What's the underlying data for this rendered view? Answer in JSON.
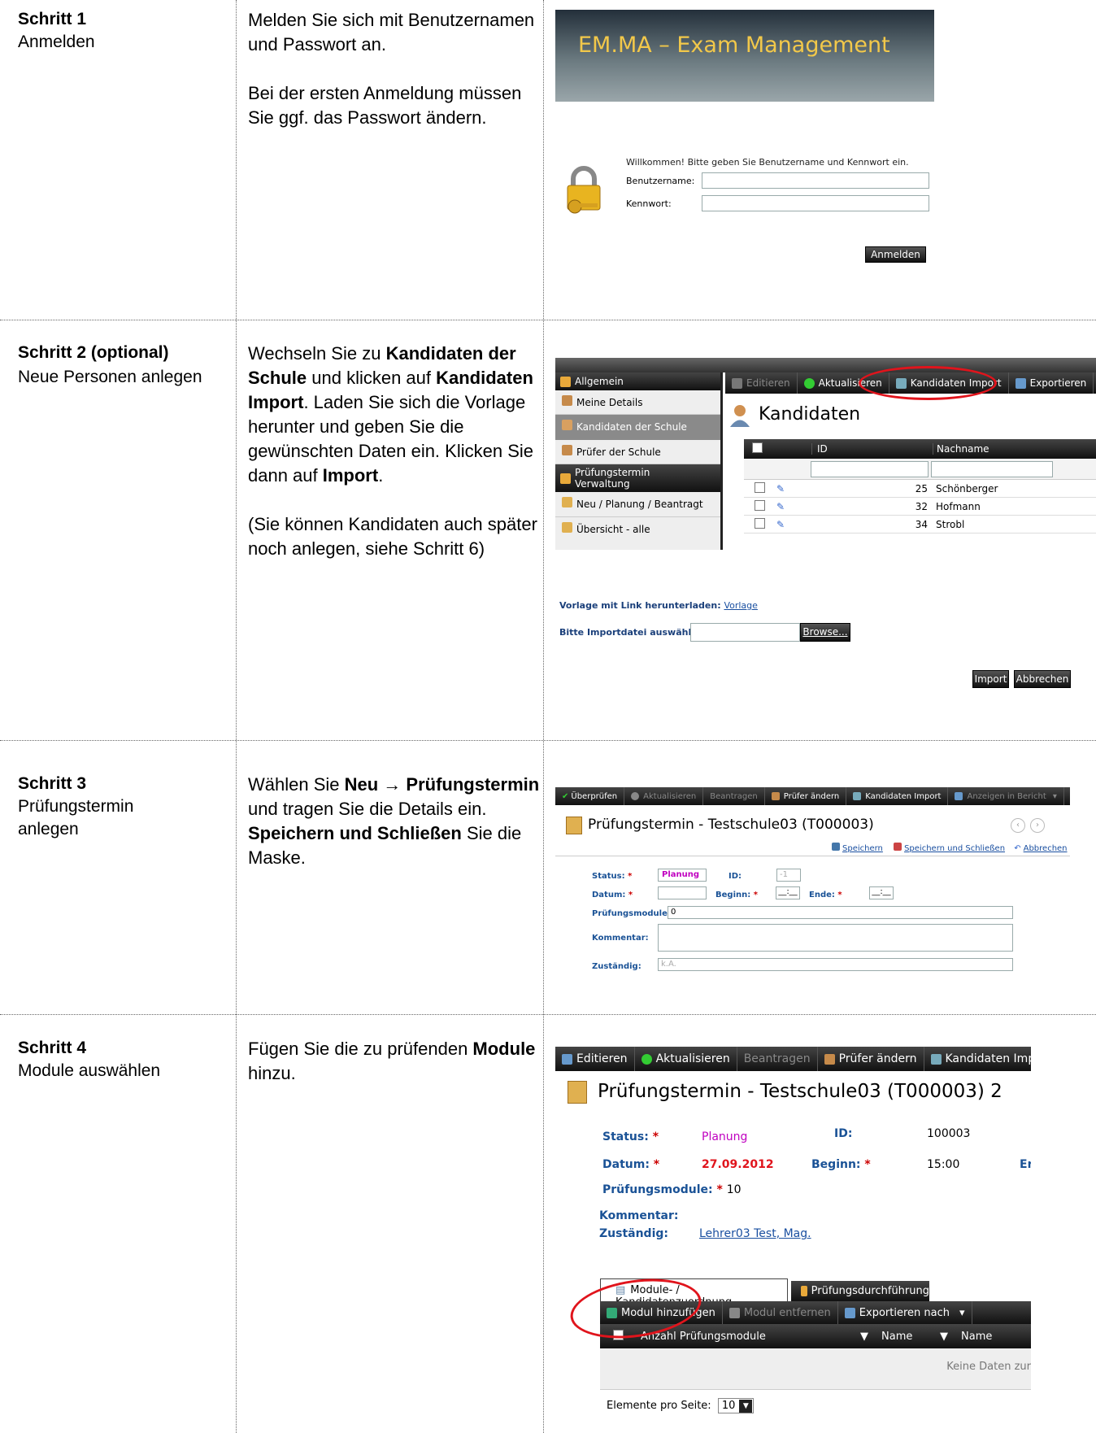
{
  "steps": [
    {
      "title": "Schritt 1",
      "subtitle": "Anmelden",
      "instruction": {
        "p1": "Melden Sie sich mit Benutzernamen und Passwort an.",
        "p2": "Bei der ersten Anmeldung müssen Sie ggf. das Passwort ändern."
      },
      "screenshot": {
        "banner_title": "EM.MA – Exam Management",
        "welcome": "Willkommen! Bitte geben Sie Benutzername und Kennwort ein.",
        "username_label": "Benutzername:",
        "username_value": "",
        "password_label": "Kennwort:",
        "password_value": "",
        "login_button": "Anmelden"
      }
    },
    {
      "title": "Schritt 2 (optional)",
      "subtitle": "Neue Personen anlegen",
      "instruction": {
        "t1": "Wechseln Sie zu ",
        "b1": "Kandidaten der Schule",
        "t2": " und klicken auf ",
        "b2": "Kandidaten Import",
        "t3": ". Laden Sie sich die Vorlage herunter und geben Sie die gewünschten Daten ein. Klicken Sie dann auf ",
        "b3": "Import",
        "t4": ".",
        "p2": "(Sie können Kandidaten auch später noch anlegen, siehe Schritt 6)"
      },
      "screenshot": {
        "sidebar_group1": "Allgemein",
        "sidebar_items": [
          "Meine Details",
          "Kandidaten der Schule",
          "Prüfer der Schule"
        ],
        "sidebar_group2": "Prüfungstermin Verwaltung",
        "sidebar_items2": [
          "Neu / Planung / Beantragt",
          "Übersicht - alle"
        ],
        "toolbar": [
          "Editieren",
          "Aktualisieren",
          "Kandidaten Import",
          "Exportieren"
        ],
        "page_title": "Kandidaten",
        "col_id": "ID",
        "col_name": "Nachname",
        "rows": [
          {
            "id": "25",
            "name": "Schönberger"
          },
          {
            "id": "32",
            "name": "Hofmann"
          },
          {
            "id": "34",
            "name": "Strobl"
          }
        ],
        "template_label": "Vorlage mit Link herunterladen:",
        "template_link": "Vorlage",
        "import_file_label": "Bitte Importdatei auswählen:",
        "browse_button": "Browse...",
        "import_button": "Import",
        "cancel_button": "Abbrechen"
      }
    },
    {
      "title": "Schritt 3",
      "subtitle": "Prüfungstermin anlegen",
      "instruction": {
        "t1": "Wählen Sie ",
        "b1": "Neu → Prüfungstermin",
        "t2": " und tragen Sie die Details ein. ",
        "b2": "Speichern und Schließen",
        "t3": " Sie die Maske."
      },
      "screenshot": {
        "toolbar": [
          "Überprüfen",
          "Aktualisieren",
          "Beantragen",
          "Prüfer ändern",
          "Kandidaten Import",
          "Anzeigen in Bericht"
        ],
        "page_title": "Prüfungstermin - Testschule03 (T000003)",
        "save": "Speichern",
        "save_close": "Speichern und Schließen",
        "cancel": "Abbrechen",
        "status_label": "Status:",
        "status_value": "Planung",
        "id_label": "ID:",
        "id_value": "-1",
        "date_label": "Datum:",
        "begin_label": "Beginn:",
        "begin_value": "__:__",
        "end_label": "Ende:",
        "end_value": "__:__",
        "modules_label": "Prüfungsmodule:",
        "modules_value": "0",
        "comment_label": "Kommentar:",
        "responsible_label": "Zuständig:",
        "responsible_value": "k.A.",
        "required_mark": "*"
      }
    },
    {
      "title": "Schritt 4",
      "subtitle": "Module auswählen",
      "instruction": {
        "t1": "Fügen Sie die zu prüfenden ",
        "b1": "Module",
        "t2": " hinzu."
      },
      "screenshot": {
        "toolbar": [
          "Editieren",
          "Aktualisieren",
          "Beantragen",
          "Prüfer ändern",
          "Kandidaten Import"
        ],
        "page_title": "Prüfungstermin - Testschule03 (T000003) 2",
        "status_label": "Status:",
        "status_value": "Planung",
        "id_label": "ID:",
        "id_value": "100003",
        "date_label": "Datum:",
        "date_value": "27.09.2012",
        "begin_label": "Beginn:",
        "begin_value": "15:00",
        "end_label_cut": "Er",
        "modules_label": "Prüfungsmodule:",
        "modules_value": "10",
        "comment_label": "Kommentar:",
        "responsible_label": "Zuständig:",
        "responsible_value": "Lehrer03 Test, Mag.",
        "tab1": "Module- / Kandidatenzuordnung",
        "tab2": "Prüfungsdurchführung",
        "sub_toolbar": [
          "Modul hinzufügen",
          "Modul entfernen",
          "Exportieren nach"
        ],
        "col1": "Anzahl Prüfungsmodule",
        "col2": "Name",
        "col3": "Name",
        "empty": "Keine Daten zur",
        "per_page_label": "Elemente pro Seite:",
        "per_page_value": "10",
        "required_mark": "*"
      }
    }
  ],
  "colors": {
    "accent_red": "#e0141c",
    "label_blue": "#1a5296",
    "status_magenta": "#c000c0"
  }
}
